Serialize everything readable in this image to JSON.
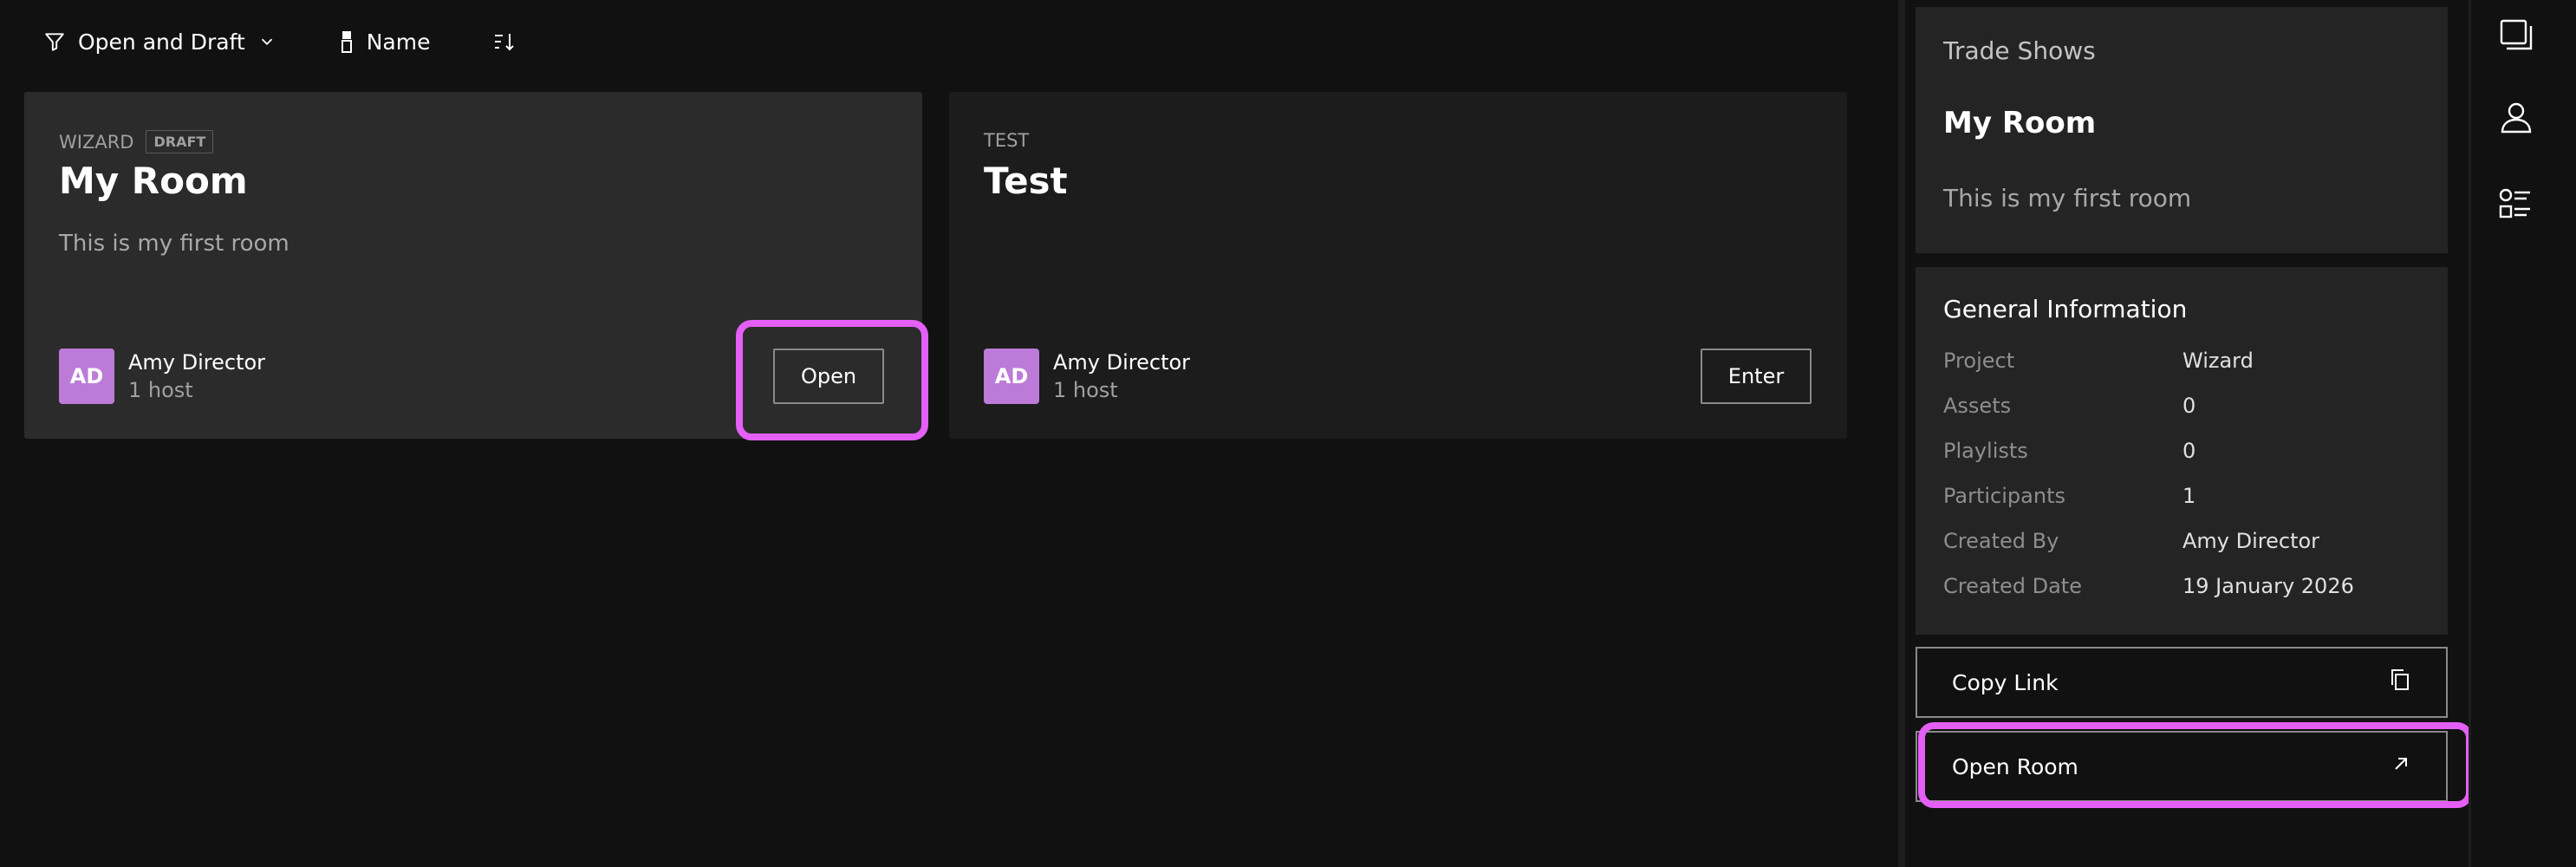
{
  "toolbar": {
    "filter_label": "Open and Draft",
    "sort_label": "Name"
  },
  "rooms": [
    {
      "label": "WIZARD",
      "badge": "DRAFT",
      "title": "My Room",
      "description": "This is my first room",
      "host_initials": "AD",
      "host_name": "Amy Director",
      "host_count": "1 host",
      "button_label": "Open"
    },
    {
      "label": "TEST",
      "title": "Test",
      "description": "",
      "host_initials": "AD",
      "host_name": "Amy Director",
      "host_count": "1 host",
      "button_label": "Enter"
    }
  ],
  "details": {
    "category": "Trade Shows",
    "title": "My Room",
    "description": "This is my first room",
    "info_heading": "General Information",
    "info": [
      {
        "key": "Project",
        "value": "Wizard"
      },
      {
        "key": "Assets",
        "value": "0"
      },
      {
        "key": "Playlists",
        "value": "0"
      },
      {
        "key": "Participants",
        "value": "1"
      },
      {
        "key": "Created By",
        "value": "Amy Director"
      },
      {
        "key": "Created Date",
        "value": "19 January 2026"
      }
    ],
    "copy_link_label": "Copy Link",
    "open_room_label": "Open Room"
  },
  "icons": {
    "filter": "filter-icon",
    "chevron": "chevron-down-icon",
    "sort_field": "sort-field-icon",
    "sort_direction": "sort-direction-icon",
    "copy": "copy-icon",
    "external": "arrow-up-right-icon",
    "rail": [
      "details-panel-icon",
      "user-icon",
      "list-settings-icon"
    ]
  },
  "colors": {
    "background": "#111111",
    "card": "#1c1c1c",
    "card_active": "#2b2b2b",
    "panel": "#242424",
    "avatar": "#bc7bd8",
    "highlight": "#e35ff5"
  }
}
